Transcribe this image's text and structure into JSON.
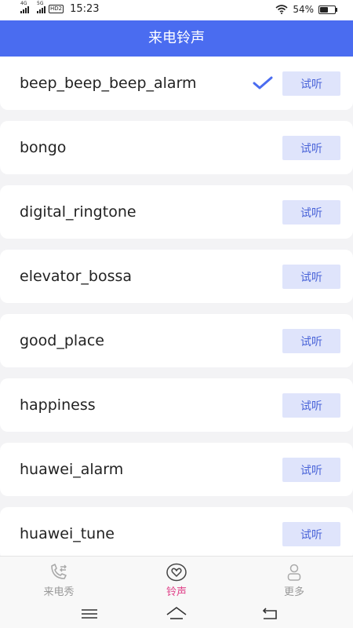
{
  "status": {
    "network1": "4G",
    "network2": "5G",
    "hd": "HD2",
    "time": "15:23",
    "battery_text": "54%",
    "battery_level": 0.54
  },
  "header": {
    "title": "来电铃声"
  },
  "ringtones": [
    {
      "name": "beep_beep_beep_alarm",
      "listen_label": "试听",
      "selected": true
    },
    {
      "name": "bongo",
      "listen_label": "试听",
      "selected": false
    },
    {
      "name": "digital_ringtone",
      "listen_label": "试听",
      "selected": false
    },
    {
      "name": "elevator_bossa",
      "listen_label": "试听",
      "selected": false
    },
    {
      "name": "good_place",
      "listen_label": "试听",
      "selected": false
    },
    {
      "name": "happiness",
      "listen_label": "试听",
      "selected": false
    },
    {
      "name": "huawei_alarm",
      "listen_label": "试听",
      "selected": false
    },
    {
      "name": "huawei_tune",
      "listen_label": "试听",
      "selected": false
    }
  ],
  "bottom_nav": [
    {
      "label": "来电秀",
      "icon": "phone-transfer-icon",
      "active": false
    },
    {
      "label": "铃声",
      "icon": "heart-icon",
      "active": true
    },
    {
      "label": "更多",
      "icon": "person-icon",
      "active": false
    }
  ],
  "colors": {
    "accent": "#4a6cf0",
    "active_tab": "#e0438a",
    "listen_bg": "#dfe4fb",
    "listen_text": "#4a64d8"
  }
}
